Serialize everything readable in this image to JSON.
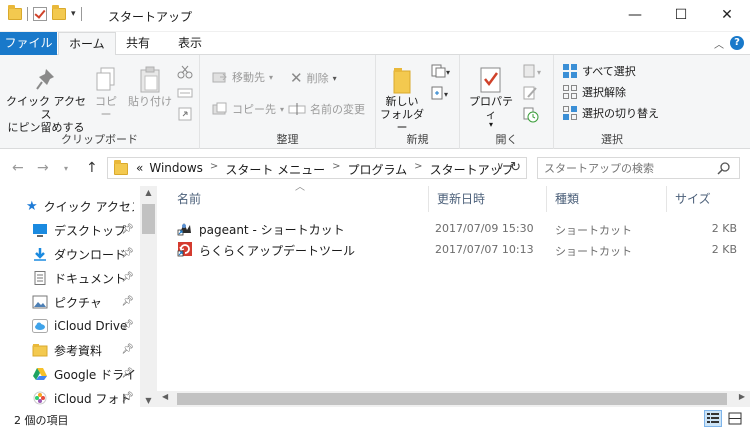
{
  "window": {
    "title": "スタートアップ",
    "minimize": "—",
    "maximize": "☐",
    "close": "✕"
  },
  "tabs": {
    "file": "ファイル",
    "home": "ホーム",
    "share": "共有",
    "view": "表示"
  },
  "ribbon": {
    "clipboard": {
      "label": "クリップボード",
      "pin_quick_line1": "クイック アクセス",
      "pin_quick_line2": "にピン留めする",
      "copy": "コピー",
      "paste": "貼り付け"
    },
    "organize": {
      "label": "整理",
      "move_to": "移動先",
      "copy_to": "コピー先",
      "delete": "削除",
      "rename": "名前の変更"
    },
    "new": {
      "label": "新規",
      "new_folder_line1": "新しい",
      "new_folder_line2": "フォルダー"
    },
    "open": {
      "label": "開く",
      "properties": "プロパティ"
    },
    "select": {
      "label": "選択",
      "select_all": "すべて選択",
      "select_none": "選択解除",
      "invert": "選択の切り替え"
    }
  },
  "address": {
    "overflow": "«",
    "crumbs": [
      "Windows",
      "スタート メニュー",
      "プログラム",
      "スタートアップ"
    ]
  },
  "search": {
    "placeholder": "スタートアップの検索"
  },
  "nav": {
    "items": [
      {
        "label": "クイック アクセス"
      },
      {
        "label": "デスクトップ"
      },
      {
        "label": "ダウンロード"
      },
      {
        "label": "ドキュメント"
      },
      {
        "label": "ピクチャ"
      },
      {
        "label": "iCloud Drive"
      },
      {
        "label": "参考資料"
      },
      {
        "label": "Google ドライブ"
      },
      {
        "label": "iCloud フォト"
      }
    ]
  },
  "columns": {
    "name": "名前",
    "modified": "更新日時",
    "type": "種類",
    "size": "サイズ"
  },
  "files": [
    {
      "name": "pageant - ショートカット",
      "modified": "2017/07/09 15:30",
      "type": "ショートカット",
      "size": "2 KB"
    },
    {
      "name": "らくらくアップデートツール",
      "modified": "2017/07/07 10:13",
      "type": "ショートカット",
      "size": "2 KB"
    }
  ],
  "status": {
    "count": "2 個の項目"
  },
  "colors": {
    "accent": "#1979ca",
    "folder": "#f3c94f",
    "ribbon_bg": "#f5f6f7"
  }
}
